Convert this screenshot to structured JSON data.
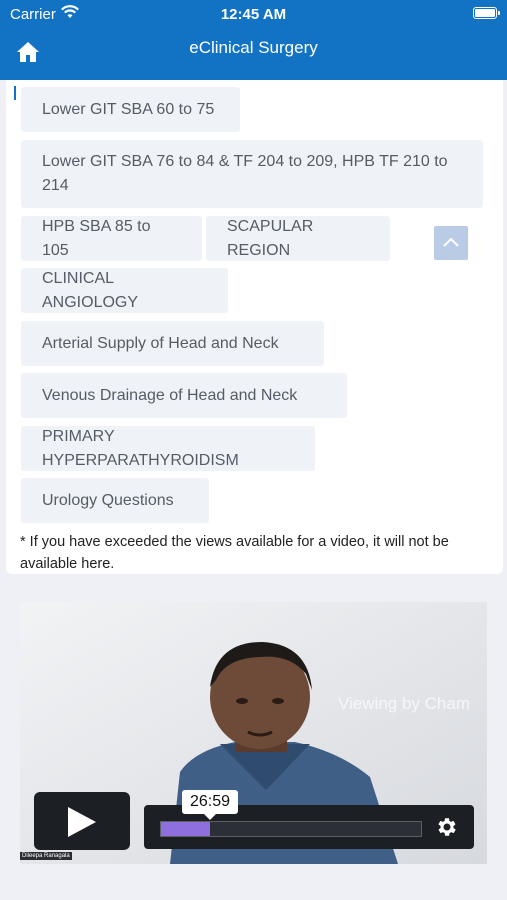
{
  "status_bar": {
    "carrier": "Carrier",
    "time": "12:45 AM"
  },
  "header": {
    "title": "eClinical Surgery",
    "home_icon": "home-icon"
  },
  "topics": [
    "Lower GIT SBA 60 to 75",
    "Lower GIT SBA 76 to 84 & TF 204 to 209, HPB TF 210 to 214",
    "HPB SBA 85 to 105",
    "SCAPULAR REGION",
    "CLINICAL ANGIOLOGY",
    "Arterial Supply of Head and Neck",
    "Venous Drainage of Head and Neck",
    "PRIMARY HYPERPARATHYROIDISM",
    "Urology Questions"
  ],
  "note": "* If you have exceeded the views available for a video, it will not be available here.",
  "video": {
    "watermark": "Viewing by Cham",
    "tooltip_time": "26:59",
    "progress": 0.19,
    "caption": "Dileepa Ranagala",
    "accent_color": "#8e6fdc"
  },
  "colors": {
    "primary": "#1272c4",
    "chip_bg": "#eff3f7"
  }
}
